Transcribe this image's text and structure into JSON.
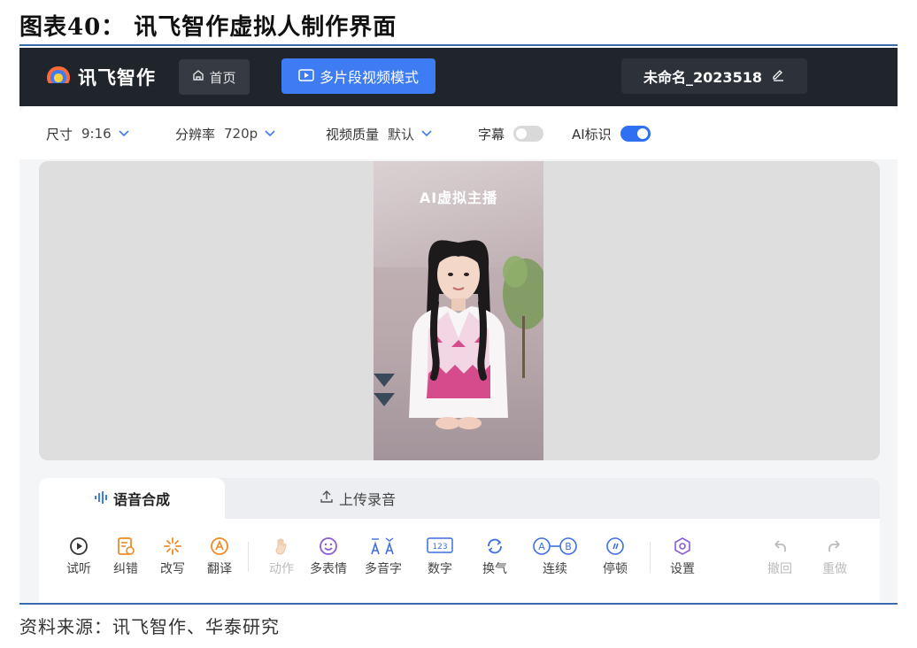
{
  "figure": {
    "title": "图表40： 讯飞智作虚拟人制作界面",
    "source": "资料来源：讯飞智作、华泰研究"
  },
  "topbar": {
    "logo_text": "讯飞智作",
    "home_label": "首页",
    "mode_label": "多片段视频模式",
    "project_name": "未命名_2023518"
  },
  "settings": {
    "size_label": "尺寸",
    "size_value": "9:16",
    "resolution_label": "分辨率",
    "resolution_value": "720p",
    "quality_label": "视频质量",
    "quality_value": "默认",
    "subtitle_label": "字幕",
    "subtitle_on": false,
    "ai_mark_label": "AI标识",
    "ai_mark_on": true
  },
  "preview": {
    "video_title": "AI虚拟主播"
  },
  "tabs": [
    {
      "label": "语音合成",
      "active": true
    },
    {
      "label": "上传录音",
      "active": false
    }
  ],
  "toolbar": {
    "items": [
      {
        "label": "试听",
        "icon": "play-circle-icon",
        "enabled": true
      },
      {
        "label": "纠错",
        "icon": "proofread-icon",
        "enabled": true
      },
      {
        "label": "改写",
        "icon": "sparkle-icon",
        "enabled": true
      },
      {
        "label": "翻译",
        "icon": "translate-icon",
        "enabled": true
      },
      {
        "label": "动作",
        "icon": "hand-icon",
        "enabled": false
      },
      {
        "label": "多表情",
        "icon": "smile-icon",
        "enabled": true
      },
      {
        "label": "多音字",
        "icon": "polyphone-icon",
        "enabled": true
      },
      {
        "label": "数字",
        "icon": "number-icon",
        "enabled": true
      },
      {
        "label": "换气",
        "icon": "breath-icon",
        "enabled": true
      },
      {
        "label": "连续",
        "icon": "link-ab-icon",
        "enabled": true
      },
      {
        "label": "停顿",
        "icon": "pause-icon",
        "enabled": true
      },
      {
        "label": "设置",
        "icon": "hexagon-settings-icon",
        "enabled": true
      },
      {
        "label": "撤回",
        "icon": "undo-icon",
        "enabled": false
      },
      {
        "label": "重做",
        "icon": "redo-icon",
        "enabled": false
      }
    ]
  },
  "colors": {
    "topbar_bg": "#20242b",
    "accent_blue": "#3d7cf2",
    "tool_orange": "#f08a24",
    "tool_purple": "#8a5cd8",
    "tool_blue": "#3f6fe0"
  }
}
